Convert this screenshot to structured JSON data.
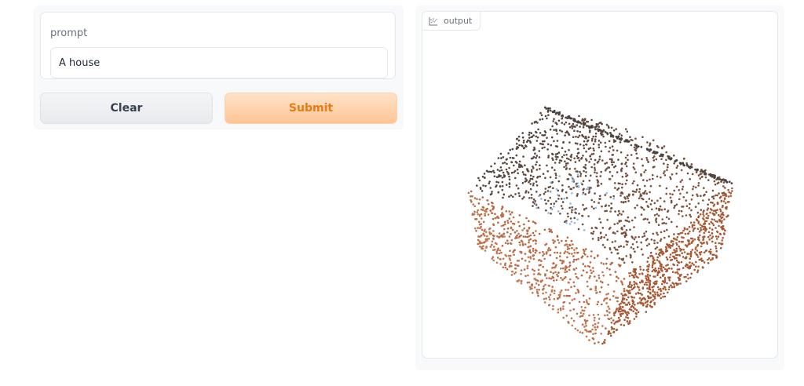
{
  "prompt": {
    "label": "prompt",
    "value": "A house"
  },
  "buttons": {
    "clear_label": "Clear",
    "submit_label": "Submit"
  },
  "output": {
    "label": "output",
    "icon": "chart-icon",
    "colors": {
      "top": "#4a4440",
      "side": "#b45c33",
      "highlight": "#8fb8e0"
    }
  },
  "colors": {
    "accent": "#ea7b12",
    "submit_bg": "#ffd3ab",
    "clear_bg": "#eceef1",
    "panel_bg": "#f8f9fb",
    "border": "#e5e7eb"
  }
}
